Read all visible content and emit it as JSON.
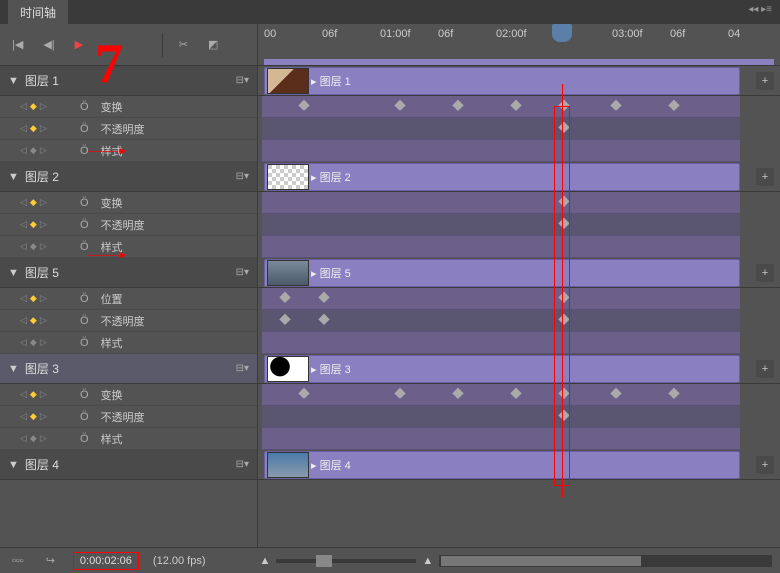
{
  "panel": {
    "tab": "时间轴"
  },
  "ruler": [
    "00",
    "06f",
    "01:00f",
    "06f",
    "02:00f",
    "06f",
    "03:00f",
    "06f",
    "04"
  ],
  "playhead_pct": 62,
  "layers": [
    {
      "name": "图层 1",
      "selected": false,
      "thumb": "t1",
      "props": [
        {
          "label": "变换",
          "hasKf": true,
          "kfs": [
            8,
            28,
            40,
            52,
            62,
            73,
            85
          ]
        },
        {
          "label": "不透明度",
          "hasKf": true,
          "kfs": [
            62
          ]
        },
        {
          "label": "样式",
          "hasKf": false,
          "kfs": []
        }
      ]
    },
    {
      "name": "图层 2",
      "selected": false,
      "thumb": "t2",
      "props": [
        {
          "label": "变换",
          "hasKf": true,
          "kfs": [
            62
          ]
        },
        {
          "label": "不透明度",
          "hasKf": true,
          "kfs": [
            62
          ]
        },
        {
          "label": "样式",
          "hasKf": false,
          "kfs": []
        }
      ]
    },
    {
      "name": "图层 5",
      "selected": false,
      "thumb": "t3",
      "props": [
        {
          "label": "位置",
          "hasKf": true,
          "kfs": [
            4,
            12,
            62
          ]
        },
        {
          "label": "不透明度",
          "hasKf": true,
          "kfs": [
            4,
            12,
            62
          ]
        },
        {
          "label": "样式",
          "hasKf": false,
          "kfs": []
        }
      ]
    },
    {
      "name": "图层 3",
      "selected": true,
      "thumb": "t4",
      "props": [
        {
          "label": "变换",
          "hasKf": true,
          "kfs": [
            8,
            28,
            40,
            52,
            62,
            73,
            85
          ]
        },
        {
          "label": "不透明度",
          "hasKf": true,
          "kfs": [
            62
          ]
        },
        {
          "label": "样式",
          "hasKf": false,
          "kfs": []
        }
      ]
    },
    {
      "name": "图层 4",
      "selected": false,
      "thumb": "t5",
      "props": []
    }
  ],
  "footer": {
    "timecode": "0:00:02:06",
    "fps": "(12.00 fps)"
  },
  "labels": {
    "clip_prefix": "▶ "
  }
}
